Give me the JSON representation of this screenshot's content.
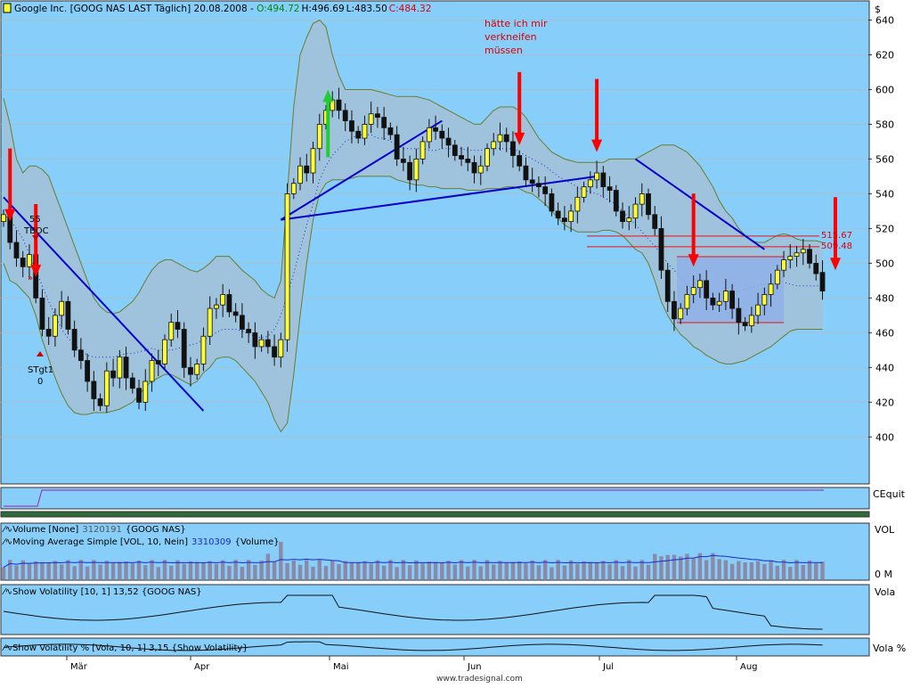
{
  "header": {
    "title": "Google Inc. [GOOG NAS LAST Täglich] 20.08.2008 - ",
    "open": "O:494.72",
    "high": "H:496.69",
    "low": "L:483.50",
    "close": "C:484.32",
    "currency": "$"
  },
  "annotations": {
    "comment_lines": [
      "hätte ich mir",
      "verkneifen",
      "müssen"
    ],
    "signal_top_lines": [
      "55",
      "TBOC"
    ],
    "signal_bottom_lines": [
      "STgt1",
      "0"
    ],
    "level_high": "515.67",
    "level_low": "509.48"
  },
  "panels": {
    "equity_label": "CEquit",
    "volume_line1_name": "Volume [None]",
    "volume_line1_value": "3120191",
    "volume_line1_symbol": "{GOOG NAS}",
    "volume_line2_name": "Moving Average Simple [VOL, 10, Nein]",
    "volume_line2_value": "3310309",
    "volume_line2_symbol": "{Volume}",
    "volume_axis_label": "VOL",
    "volume_axis_tick": "0 M",
    "vola_line": "Show Volatility [10, 1] 13,52 {GOOG NAS}",
    "vola_axis_label": "Vola",
    "volapct_line": "Show Volatility % [Vola, 10, 1] 3,15 {Show Volatility}",
    "volapct_axis_label": "Vola %"
  },
  "footer": {
    "watermark": "www.tradesignal.com"
  },
  "colors": {
    "panel_bg": "#87cefa",
    "band_fill": "#9fc3dc",
    "band_line": "#6b7d2e",
    "candle_up": "#ffff33",
    "candle_down": "#111111",
    "trendline": "#0000cc",
    "arrow_red": "#ff0000",
    "arrow_green": "#22cc33",
    "level_red": "#ee1111",
    "volume_bar": "#8a8aa8",
    "grid": "#b9b9b9"
  },
  "chart_data": {
    "type": "candlestick",
    "title": "Google Inc. [GOOG NAS LAST Täglich] 20.08.2008",
    "x_labels": [
      "Mär",
      "Apr",
      "Mai",
      "Jun",
      "Jul",
      "Aug"
    ],
    "y_ticks": [
      400,
      420,
      440,
      460,
      480,
      500,
      520,
      540,
      560,
      580,
      600,
      620,
      640
    ],
    "ylim": [
      374,
      650
    ],
    "last_bar": {
      "open": 494.72,
      "high": 496.69,
      "low": 483.5,
      "close": 484.32
    },
    "closes": [
      528,
      512,
      503,
      498,
      505,
      480,
      462,
      458,
      470,
      478,
      462,
      450,
      444,
      432,
      422,
      418,
      438,
      434,
      446,
      434,
      428,
      420,
      432,
      444,
      442,
      456,
      466,
      462,
      440,
      436,
      442,
      458,
      474,
      476,
      482,
      472,
      470,
      462,
      460,
      452,
      456,
      452,
      446,
      456,
      540,
      546,
      556,
      552,
      566,
      580,
      588,
      594,
      588,
      582,
      576,
      572,
      580,
      586,
      584,
      578,
      574,
      560,
      558,
      548,
      560,
      570,
      578,
      576,
      572,
      568,
      562,
      560,
      558,
      552,
      556,
      566,
      570,
      574,
      570,
      562,
      556,
      548,
      546,
      544,
      540,
      530,
      526,
      524,
      530,
      538,
      544,
      548,
      552,
      544,
      542,
      530,
      524,
      526,
      534,
      540,
      528,
      520,
      496,
      478,
      468,
      474,
      482,
      486,
      490,
      480,
      476,
      478,
      484,
      474,
      466,
      464,
      470,
      476,
      482,
      488,
      496,
      502,
      504,
      506,
      508,
      500,
      494,
      484
    ],
    "bollinger_upper": [
      595,
      580,
      560,
      552,
      556,
      556,
      554,
      550,
      540,
      530,
      520,
      510,
      500,
      490,
      480,
      475,
      472,
      471,
      472,
      475,
      478,
      483,
      490,
      496,
      500,
      502,
      502,
      500,
      498,
      496,
      495,
      497,
      500,
      504,
      504,
      504,
      500,
      496,
      493,
      490,
      485,
      482,
      480,
      490,
      540,
      590,
      620,
      630,
      638,
      640,
      636,
      620,
      608,
      600,
      600,
      600,
      600,
      600,
      599,
      598,
      597,
      596,
      596,
      596,
      596,
      595,
      594,
      592,
      590,
      588,
      586,
      584,
      582,
      580,
      580,
      584,
      588,
      590,
      590,
      590,
      588,
      584,
      578,
      572,
      568,
      564,
      562,
      560,
      559,
      558,
      558,
      558,
      558,
      558,
      560,
      560,
      560,
      560,
      560,
      562,
      564,
      566,
      568,
      568,
      568,
      566,
      564,
      560,
      556,
      550,
      544,
      536,
      530,
      526,
      520,
      516,
      513,
      512,
      512,
      514,
      516,
      517,
      516,
      514,
      513,
      513,
      513,
      512
    ],
    "bollinger_lower": [
      500,
      490,
      488,
      484,
      480,
      470,
      456,
      445,
      434,
      425,
      418,
      414,
      413,
      413,
      414,
      414,
      414,
      415,
      416,
      418,
      420,
      424,
      429,
      432,
      434,
      436,
      436,
      434,
      432,
      430,
      432,
      437,
      440,
      445,
      446,
      446,
      444,
      440,
      436,
      432,
      426,
      420,
      410,
      403,
      408,
      436,
      470,
      500,
      525,
      540,
      546,
      548,
      548,
      548,
      549,
      550,
      550,
      550,
      550,
      550,
      550,
      548,
      547,
      546,
      545,
      545,
      544,
      544,
      543,
      543,
      543,
      543,
      542,
      542,
      542,
      543,
      543,
      543,
      544,
      544,
      543,
      541,
      540,
      537,
      534,
      530,
      526,
      522,
      520,
      518,
      518,
      518,
      518,
      519,
      519,
      518,
      516,
      512,
      508,
      506,
      500,
      490,
      478,
      470,
      464,
      459,
      456,
      452,
      450,
      447,
      445,
      443,
      442,
      442,
      443,
      444,
      446,
      448,
      450,
      452,
      455,
      458,
      461,
      462,
      462,
      462,
      462,
      462
    ],
    "average_dotted": [
      528,
      525,
      520,
      514,
      505,
      496,
      487,
      478,
      470,
      462,
      457,
      453,
      450,
      447,
      446,
      446,
      446,
      446,
      447,
      448,
      448,
      449,
      450,
      451,
      450,
      450,
      450,
      451,
      452,
      453,
      454,
      456,
      458,
      460,
      462,
      462,
      462,
      461,
      459,
      458,
      457,
      458,
      462,
      470,
      482,
      494,
      508,
      522,
      534,
      548,
      556,
      562,
      566,
      570,
      572,
      574,
      574,
      574,
      572,
      572,
      570,
      568,
      566,
      566,
      566,
      566,
      565,
      565,
      566,
      566,
      566,
      566,
      565,
      565,
      565,
      566,
      566,
      566,
      566,
      566,
      564,
      562,
      560,
      558,
      556,
      553,
      550,
      548,
      546,
      544,
      542,
      541,
      540,
      538,
      536,
      534,
      530,
      526,
      522,
      518,
      514,
      510,
      505,
      500,
      496,
      492,
      488,
      485,
      483,
      482,
      482,
      482,
      482,
      483,
      484,
      485,
      486,
      487,
      488,
      489,
      489,
      489,
      488,
      487,
      487,
      487,
      487,
      487
    ],
    "levels": [
      515.67,
      509.48
    ],
    "trendlines": [
      {
        "from_bar": 0,
        "from_price": 538,
        "to_bar": 31,
        "to_price": 415
      },
      {
        "from_bar": 43,
        "from_price": 525,
        "to_bar": 68,
        "to_price": 582
      },
      {
        "from_bar": 43,
        "from_price": 525,
        "to_bar": 92,
        "to_price": 550
      },
      {
        "from_bar": 98,
        "from_price": 560,
        "to_bar": 118,
        "to_price": 508
      }
    ],
    "red_arrow_bars": [
      1,
      5,
      80,
      92,
      107,
      129
    ],
    "green_arrow_bar": 51,
    "volume_ma_last": 3310309,
    "volume_last": 3120191
  }
}
